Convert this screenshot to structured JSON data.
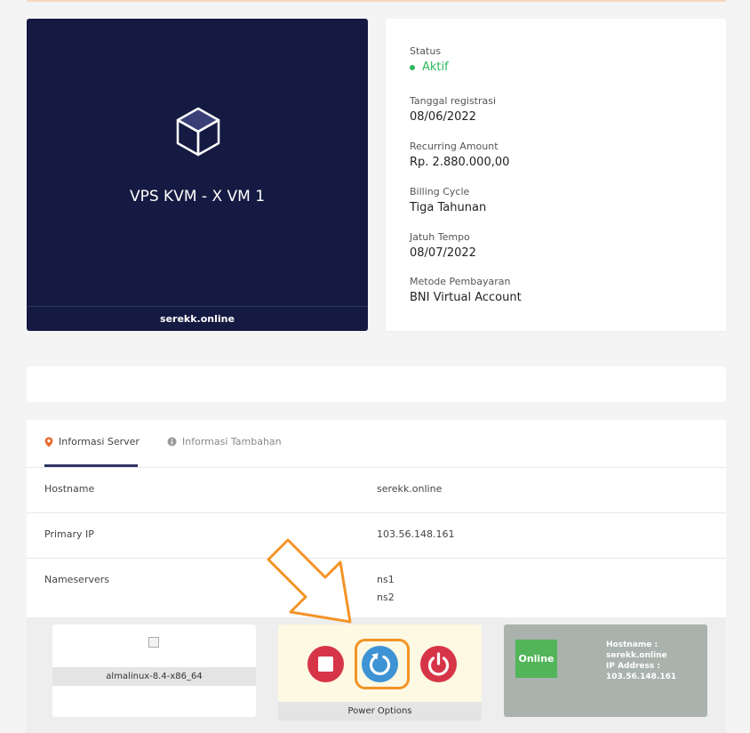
{
  "product": {
    "name": "VPS KVM - X VM 1",
    "domain": "serekk.online"
  },
  "details": {
    "status_label": "Status",
    "status_value": "Aktif",
    "reg_label": "Tanggal registrasi",
    "reg_value": "08/06/2022",
    "amount_label": "Recurring Amount",
    "amount_value": "Rp. 2.880.000,00",
    "cycle_label": "Billing Cycle",
    "cycle_value": "Tiga Tahunan",
    "due_label": "Jatuh Tempo",
    "due_value": "08/07/2022",
    "payment_label": "Metode Pembayaran",
    "payment_value": "BNI Virtual Account"
  },
  "tabs": {
    "server_info": "Informasi Server",
    "extra_info": "Informasi Tambahan"
  },
  "server": {
    "hostname_label": "Hostname",
    "hostname_value": "serekk.online",
    "ip_label": "Primary IP",
    "ip_value": "103.56.148.161",
    "ns_label": "Nameservers",
    "ns1": "ns1",
    "ns2": "ns2"
  },
  "widgets": {
    "os_label": "almalinux-8.4-x86_64",
    "power_label": "Power Options",
    "online_badge": "Online",
    "status_hostname_label": "Hostname :",
    "status_hostname_value": "serekk.online",
    "status_ip_label": "IP Address :",
    "status_ip_value": "103.56.148.161"
  },
  "colors": {
    "product_bg": "#151a42",
    "active_green": "#2eb85c",
    "tab_accent": "#2d3466",
    "tab_icon": "#e86a2c",
    "power_red": "#d63547",
    "power_blue": "#3d93d3",
    "highlight_orange": "#f39326",
    "online_green": "#52b559"
  },
  "icons": {
    "product": "cube-icon",
    "tab_server": "map-pin-icon",
    "tab_extra": "info-circle-icon",
    "stop": "stop-icon",
    "restart": "restart-icon",
    "power": "power-icon",
    "annotation": "arrow-down-right-icon"
  }
}
